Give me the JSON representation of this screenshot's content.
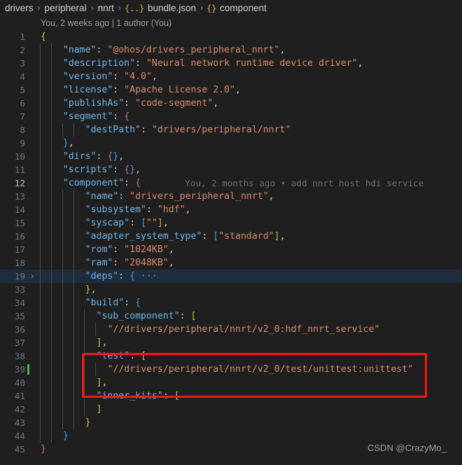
{
  "breadcrumb": {
    "separator": "›",
    "items": [
      {
        "label": "drivers",
        "icon": ""
      },
      {
        "label": "peripheral",
        "icon": ""
      },
      {
        "label": "nnrt",
        "icon": ""
      },
      {
        "label": "bundle.json",
        "icon": "json-file-icon",
        "glyph": "{..}"
      },
      {
        "label": "component",
        "icon": "json-object-icon",
        "glyph": "{}"
      }
    ]
  },
  "blame": {
    "header": "You, 2 weeks ago | 1 author (You)",
    "inline_line12": "You, 2 months ago • add nnrt host hdi service"
  },
  "editor": {
    "language": "json",
    "filename": "bundle.json",
    "folded_line": 19,
    "fold_chevron": "›",
    "git_added_line": 39,
    "highlight_line": 19,
    "lines": [
      {
        "n": "1",
        "text": "{"
      },
      {
        "n": "2",
        "text": "    \"name\": \"@ohos/drivers_peripheral_nnrt\","
      },
      {
        "n": "3",
        "text": "    \"description\": \"Neural network runtime device driver\","
      },
      {
        "n": "4",
        "text": "    \"version\": \"4.0\","
      },
      {
        "n": "5",
        "text": "    \"license\": \"Apache License 2.0\","
      },
      {
        "n": "6",
        "text": "    \"publishAs\": \"code-segment\","
      },
      {
        "n": "7",
        "text": "    \"segment\": {"
      },
      {
        "n": "8",
        "text": "        \"destPath\": \"drivers/peripheral/nnrt\""
      },
      {
        "n": "9",
        "text": "    },"
      },
      {
        "n": "10",
        "text": "    \"dirs\": {},"
      },
      {
        "n": "11",
        "text": "    \"scripts\": {},"
      },
      {
        "n": "12",
        "text": "    \"component\": {"
      },
      {
        "n": "13",
        "text": "        \"name\": \"drivers_peripheral_nnrt\","
      },
      {
        "n": "14",
        "text": "        \"subsystem\": \"hdf\","
      },
      {
        "n": "15",
        "text": "        \"syscap\": [\"\"],"
      },
      {
        "n": "16",
        "text": "        \"adapter_system_type\": [\"standard\"],"
      },
      {
        "n": "17",
        "text": "        \"rom\": \"1024KB\","
      },
      {
        "n": "18",
        "text": "        \"ram\": \"2048KB\","
      },
      {
        "n": "19",
        "text": "        \"deps\": { ···"
      },
      {
        "n": "33",
        "text": "        },"
      },
      {
        "n": "34",
        "text": "        \"build\": {"
      },
      {
        "n": "35",
        "text": "          \"sub_component\": ["
      },
      {
        "n": "36",
        "text": "            \"//drivers/peripheral/nnrt/v2_0:hdf_nnrt_service\""
      },
      {
        "n": "37",
        "text": "          ],"
      },
      {
        "n": "38",
        "text": "          \"test\": ["
      },
      {
        "n": "39",
        "text": "            \"//drivers/peripheral/nnrt/v2_0/test/unittest:unittest\""
      },
      {
        "n": "40",
        "text": "          ],"
      },
      {
        "n": "41",
        "text": "          \"inner_kits\": ["
      },
      {
        "n": "42",
        "text": "          ]"
      },
      {
        "n": "43",
        "text": "        }"
      },
      {
        "n": "44",
        "text": "    }"
      },
      {
        "n": "45",
        "text": "}"
      }
    ]
  },
  "annotation": {
    "label": "test-array-highlight",
    "color": "#f01b13",
    "covers_lines": [
      38,
      39,
      40
    ]
  },
  "watermark": {
    "text": "CSDN @CrazyMo_"
  },
  "theme": {
    "background": "#1f1f1f",
    "line_number": "#6e7681",
    "key": "#6fb4e8",
    "string": "#d98a6a",
    "bracket_yellow": "#d6bb4f",
    "bracket_pink": "#d060c8",
    "bracket_blue": "#3fa0e0",
    "git_added": "#3fb950",
    "fold_highlight": "#1d2d3e"
  }
}
